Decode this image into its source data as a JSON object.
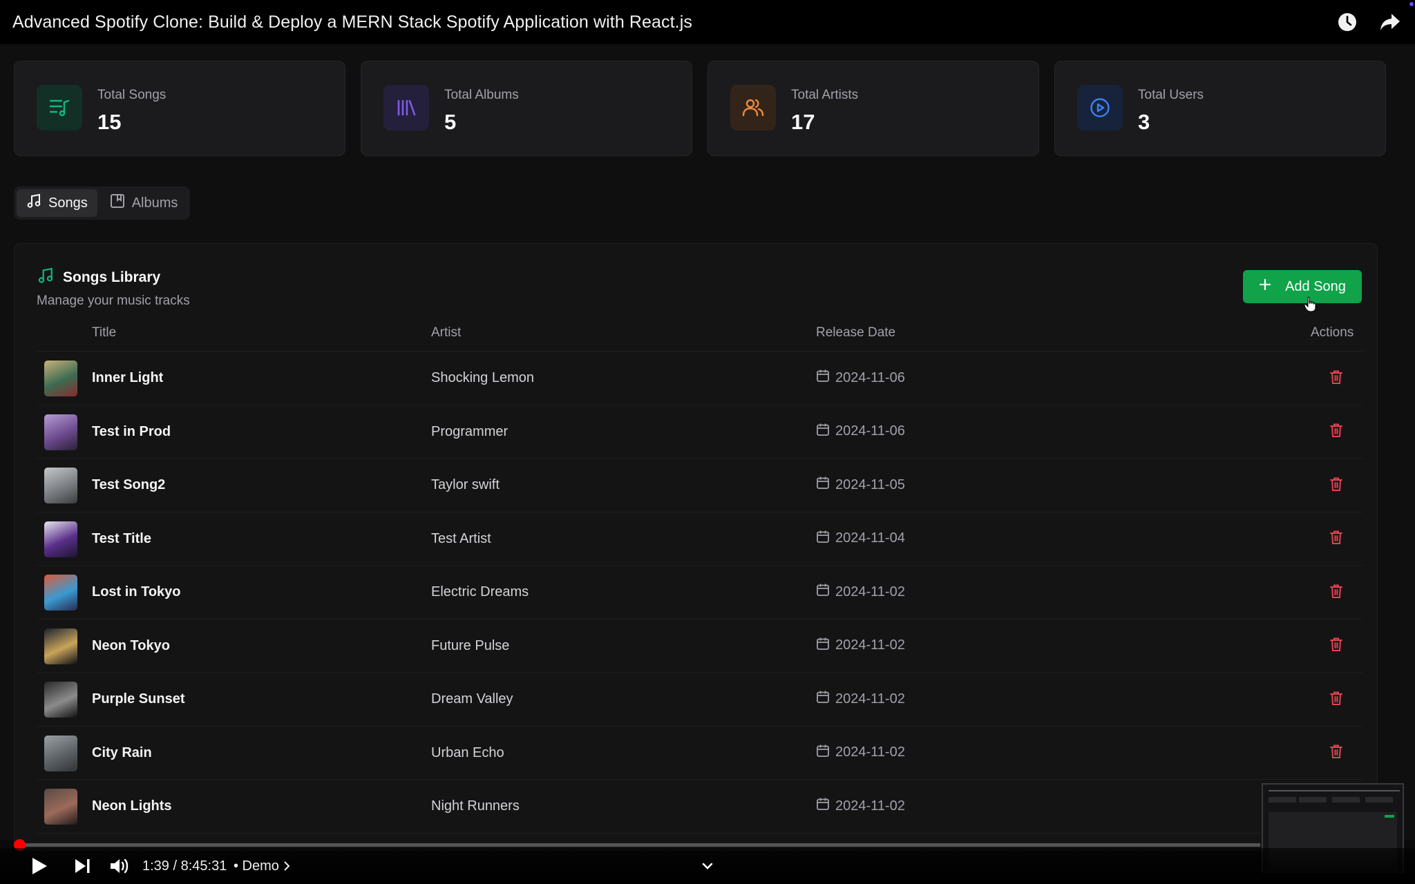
{
  "video": {
    "title": "Advanced Spotify Clone: Build & Deploy a MERN Stack Spotify Application with React.js",
    "time": "1:39 / 8:45:31",
    "chapter": "• Demo",
    "progress": 0.0032
  },
  "stats": [
    {
      "label": "Total Songs",
      "value": "15",
      "icon": "list-music-icon",
      "color": "#10b981",
      "bg": "#123026"
    },
    {
      "label": "Total Albums",
      "value": "5",
      "icon": "library-icon",
      "color": "#7c5ce6",
      "bg": "#241f3a"
    },
    {
      "label": "Total Artists",
      "value": "17",
      "icon": "users-icon",
      "color": "#f08a3c",
      "bg": "#33241a"
    },
    {
      "label": "Total Users",
      "value": "3",
      "icon": "play-circle-icon",
      "color": "#3b82f6",
      "bg": "#17233a"
    }
  ],
  "tabs": [
    {
      "label": "Songs",
      "icon": "music-icon",
      "active": true
    },
    {
      "label": "Albums",
      "icon": "album-icon",
      "active": false
    }
  ],
  "library": {
    "title": "Songs Library",
    "subtitle": "Manage your music tracks",
    "add_label": "Add Song"
  },
  "table": {
    "headers": [
      "Title",
      "Artist",
      "Release Date",
      "Actions"
    ],
    "rows": [
      {
        "title": "Inner Light",
        "artist": "Shocking Lemon",
        "date": "2024-11-06",
        "thumb": [
          "#c9b27a",
          "#3d6b52",
          "#8a2c2c"
        ]
      },
      {
        "title": "Test in Prod",
        "artist": "Programmer",
        "date": "2024-11-06",
        "thumb": [
          "#b59cd6",
          "#6d4c8f",
          "#2b1f36"
        ]
      },
      {
        "title": "Test Song2",
        "artist": "Taylor swift",
        "date": "2024-11-05",
        "thumb": [
          "#c6c8ca",
          "#7b7f83",
          "#3a3d40"
        ]
      },
      {
        "title": "Test Title",
        "artist": "Test Artist",
        "date": "2024-11-04",
        "thumb": [
          "#e9e6f2",
          "#5a2f8a",
          "#1c1530"
        ]
      },
      {
        "title": "Lost in Tokyo",
        "artist": "Electric Dreams",
        "date": "2024-11-02",
        "thumb": [
          "#e05a3a",
          "#3a9ad0",
          "#2a2a50"
        ]
      },
      {
        "title": "Neon Tokyo",
        "artist": "Future Pulse",
        "date": "2024-11-02",
        "thumb": [
          "#1a2230",
          "#c9a45a",
          "#0c0f16"
        ]
      },
      {
        "title": "Purple Sunset",
        "artist": "Dream Valley",
        "date": "2024-11-02",
        "thumb": [
          "#2a2a2a",
          "#8c8c8c",
          "#111111"
        ]
      },
      {
        "title": "City Rain",
        "artist": "Urban Echo",
        "date": "2024-11-02",
        "thumb": [
          "#9aa0a4",
          "#5c6266",
          "#2f3336"
        ]
      },
      {
        "title": "Neon Lights",
        "artist": "Night Runners",
        "date": "2024-11-02",
        "thumb": [
          "#5a4a44",
          "#9c6a5a",
          "#231a18"
        ]
      }
    ]
  }
}
